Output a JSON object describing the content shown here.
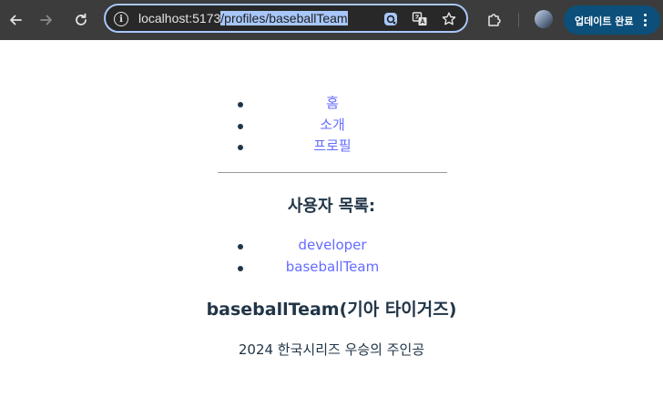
{
  "browser": {
    "url_host": "localhost:5173",
    "url_path": "/profiles/baseballTeam",
    "update_button_label": "업데이트 완료",
    "icons": [
      "back-arrow-icon",
      "forward-arrow-icon",
      "reload-icon",
      "site-info-icon",
      "lens-icon",
      "translate-icon",
      "bookmark-star-icon",
      "extensions-icon",
      "profile-avatar",
      "more-vert-icon"
    ],
    "accent_color": "#a8c7fa"
  },
  "nav": {
    "items": [
      {
        "label": "홈"
      },
      {
        "label": "소개"
      },
      {
        "label": "프로필"
      }
    ]
  },
  "users": {
    "heading": "사용자 목록:",
    "items": [
      {
        "label": "developer"
      },
      {
        "label": "baseballTeam"
      }
    ]
  },
  "profile": {
    "title": "baseballTeam(기아 타이거즈)",
    "description": "2024 한국시리즈 우승의 주인공"
  },
  "colors": {
    "link": "#646cff",
    "text": "#213547",
    "chrome_bg": "#3c3c3c",
    "update_button_bg": "#0b4f7a"
  }
}
